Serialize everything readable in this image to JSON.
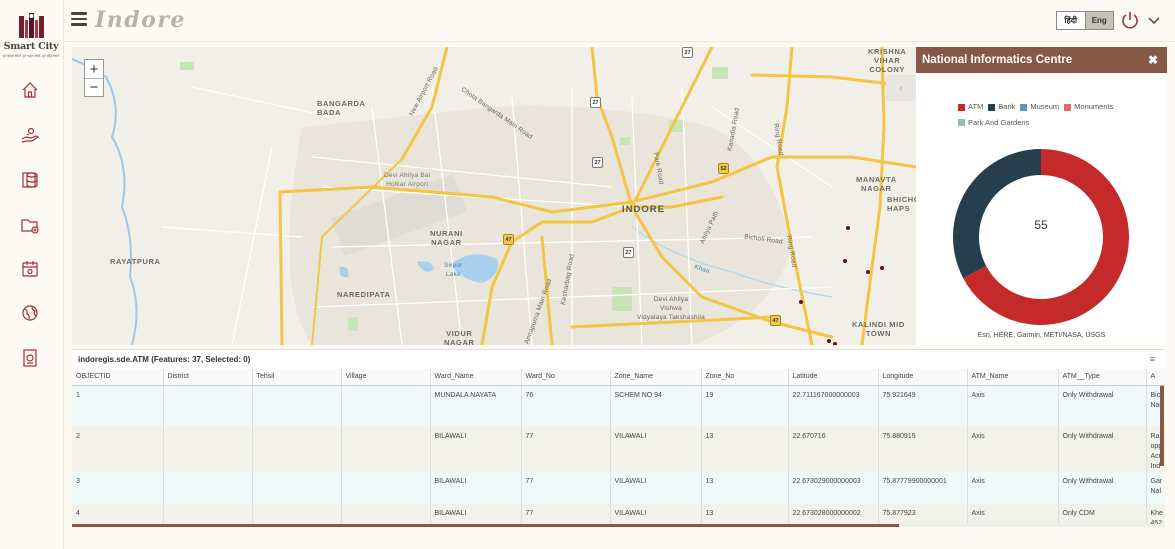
{
  "app": {
    "title": "Indore"
  },
  "logo": {
    "line1": "Smart City",
    "line2": "हर कदम स्मार्ट, हर पहल स्मार्ट, हर कोई स्मार्ट"
  },
  "sidebar": {
    "items": [
      {
        "name": "home",
        "icon": "home-icon"
      },
      {
        "name": "services",
        "icon": "hand-coins-icon"
      },
      {
        "name": "data",
        "icon": "database-icon"
      },
      {
        "name": "folder",
        "icon": "folder-add-icon"
      },
      {
        "name": "calendar",
        "icon": "calendar-icon"
      },
      {
        "name": "globe",
        "icon": "globe-icon"
      },
      {
        "name": "report",
        "icon": "report-icon"
      }
    ]
  },
  "header": {
    "lang_hi": "हिंदी",
    "lang_en": "Eng"
  },
  "map": {
    "zoom_in": "+",
    "zoom_out": "−",
    "labels": {
      "bangarda": "BANGARDA\nBADA",
      "krishna": "KRISHNA\nVIHAR\nCOLONY",
      "indore": "INDORE",
      "nurani": "NURANI\nNAGAR",
      "rayatpura": "RAYATPURA",
      "naredipata": "NAREDIPATA",
      "vidur": "VIDUR\nNAGAR",
      "manavta": "MANAVTA\nNAGAR",
      "bhicho": "BHICHO\nHAPS",
      "kalindi": "KALINDI MID\nTOWN",
      "airport": "Devi Ahilya Bai\nHolkar Airport",
      "sirpur": "Sirpur\nLake",
      "university": "Devi Ahilya\nVishwa\nVidyalaya Takshashila",
      "new_airport_rd": "New Airport Road",
      "chota_rd": "Chota Bangarda Main Road",
      "park_rd": "Park Road",
      "ring_rd": "Ring Road",
      "ring_rd2": "Ring Road",
      "ahilya_path": "Ahilya Path",
      "bicholi_rd": "Bicholi Road",
      "kesharbag_rd": "Kesharbag Road",
      "annapurna_rd": "Annapurna Main Road",
      "kanadia_rd": "Kanadia Road",
      "khan": "Khan"
    },
    "shields": [
      "27",
      "27",
      "52",
      "47",
      "27",
      "47",
      "27"
    ]
  },
  "panel": {
    "title": "National Informatics Centre",
    "close": "✖",
    "collapse": "‹",
    "legend": [
      {
        "label": "ATM",
        "color": "#c42a2a"
      },
      {
        "label": "Bank",
        "color": "#273f4d"
      },
      {
        "label": "Museum",
        "color": "#5a9ab3"
      },
      {
        "label": "Monuments",
        "color": "#d87458"
      },
      {
        "label": "Park And Gardens",
        "color": "#8fc4a7"
      }
    ],
    "total": "55",
    "attribution": "Esri, HERE, Garmin, METI/NASA, USGS"
  },
  "chart_data": {
    "type": "pie",
    "categories": [
      "ATM",
      "Bank",
      "Museum",
      "Monuments",
      "Park And Gardens"
    ],
    "values": [
      37,
      18,
      0,
      0,
      0
    ],
    "total": 55
  },
  "table": {
    "title": "indoregis.sde.ATM (Features: 37, Selected: 0)",
    "menu": "≡",
    "columns": [
      "OBJECTID",
      "District",
      "Tehsil",
      "Village",
      "Ward_Name",
      "Ward_No",
      "Zone_Name",
      "Zone_No",
      "Latitude",
      "Longitude",
      "ATM_Name",
      "ATM__Type",
      "A"
    ],
    "rows": [
      {
        "OBJECTID": "1",
        "District": "",
        "Tehsil": "",
        "Village": "",
        "Ward_Name": "MUNDALA NAYATA",
        "Ward_No": "76",
        "Zone_Name": "SCHEM NO 94",
        "Zone_No": "19",
        "Latitude": "22.711167000000003",
        "Longitude": "75.921649",
        "ATM_Name": "Axis",
        "ATM__Type": "Only Withdrawal",
        "A": "Bic\nNag"
      },
      {
        "OBJECTID": "2",
        "District": "",
        "Tehsil": "",
        "Village": "",
        "Ward_Name": "BILAWALI",
        "Ward_No": "77",
        "Zone_Name": "VILAWALI",
        "Zone_No": "13",
        "Latitude": "22.670716",
        "Longitude": "75.880915",
        "ATM_Name": "Axis",
        "ATM__Type": "Only Withdrawal",
        "A": "Rar\nopp\nAce\nInd"
      },
      {
        "OBJECTID": "3",
        "District": "",
        "Tehsil": "",
        "Village": "",
        "Ward_Name": "BILAWALI",
        "Ward_No": "77",
        "Zone_Name": "VILAWALI",
        "Zone_No": "13",
        "Latitude": "22.673029000000003",
        "Longitude": "75.87779900000001",
        "ATM_Name": "Axis",
        "ATM__Type": "Only Withdrawal",
        "A": "Gar\nNal"
      },
      {
        "OBJECTID": "4",
        "District": "",
        "Tehsil": "",
        "Village": "",
        "Ward_Name": "BILAWALI",
        "Ward_No": "77",
        "Zone_Name": "VILAWALI",
        "Zone_No": "13",
        "Latitude": "22.673028000000002",
        "Longitude": "75.877923",
        "ATM_Name": "Axis",
        "ATM__Type": "Only CDM",
        "A": "Khe\n452"
      }
    ]
  }
}
